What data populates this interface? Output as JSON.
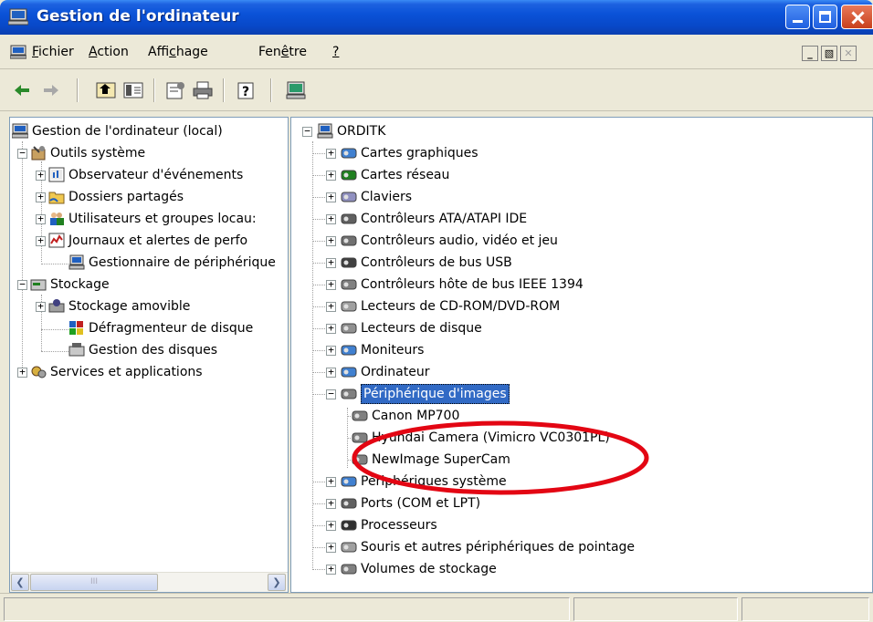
{
  "window": {
    "title": "Gestion de l'ordinateur"
  },
  "menu": {
    "items": [
      {
        "key": "F",
        "rest": "ichier"
      },
      {
        "key": "A",
        "rest": "ction"
      },
      {
        "pre": "Affi",
        "key": "c",
        "rest": "hage"
      },
      {
        "pre": "Fen",
        "key": "ê",
        "rest": "tre"
      },
      {
        "key": "?",
        "rest": ""
      }
    ]
  },
  "toolbar": {
    "icons": [
      "back-arrow-icon",
      "forward-arrow-icon",
      "up-folder-icon",
      "show-hide-tree-icon",
      "properties-icon",
      "print-icon",
      "help-icon",
      "computer-icon"
    ]
  },
  "left_tree": {
    "root": "Gestion de l'ordinateur (local)",
    "items": [
      {
        "label": "Outils système"
      },
      {
        "label": "Observateur d'événements"
      },
      {
        "label": "Dossiers partagés"
      },
      {
        "label": "Utilisateurs et groupes locau:"
      },
      {
        "label": "Journaux et alertes de perfo"
      },
      {
        "label": "Gestionnaire de périphérique"
      },
      {
        "label": "Stockage"
      },
      {
        "label": "Stockage amovible"
      },
      {
        "label": "Défragmenteur de disque"
      },
      {
        "label": "Gestion des disques"
      },
      {
        "label": "Services et applications"
      }
    ],
    "scroll_thumb_label": "III"
  },
  "right_tree": {
    "root": "ORDITK",
    "items": [
      {
        "label": "Cartes graphiques"
      },
      {
        "label": "Cartes réseau"
      },
      {
        "label": "Claviers"
      },
      {
        "label": "Contrôleurs ATA/ATAPI IDE"
      },
      {
        "label": "Contrôleurs audio, vidéo et jeu"
      },
      {
        "label": "Contrôleurs de bus USB"
      },
      {
        "label": "Contrôleurs hôte de bus IEEE 1394"
      },
      {
        "label": "Lecteurs de CD-ROM/DVD-ROM"
      },
      {
        "label": "Lecteurs de disque"
      },
      {
        "label": "Moniteurs"
      },
      {
        "label": "Ordinateur"
      },
      {
        "label": "Périphérique d'images"
      },
      {
        "label": "Canon MP700"
      },
      {
        "label": "Hyundai Camera (Vimicro VC0301PL)"
      },
      {
        "label": "NewImage SuperCam"
      },
      {
        "label": "Périphériques système"
      },
      {
        "label": "Ports (COM et LPT)"
      },
      {
        "label": "Processeurs"
      },
      {
        "label": "Souris et autres périphériques de pointage"
      },
      {
        "label": "Volumes de stockage"
      }
    ]
  },
  "colors": {
    "title_bar": "#0a52d8",
    "selection": "#316ac5",
    "highlight_ellipse": "#e30613"
  }
}
